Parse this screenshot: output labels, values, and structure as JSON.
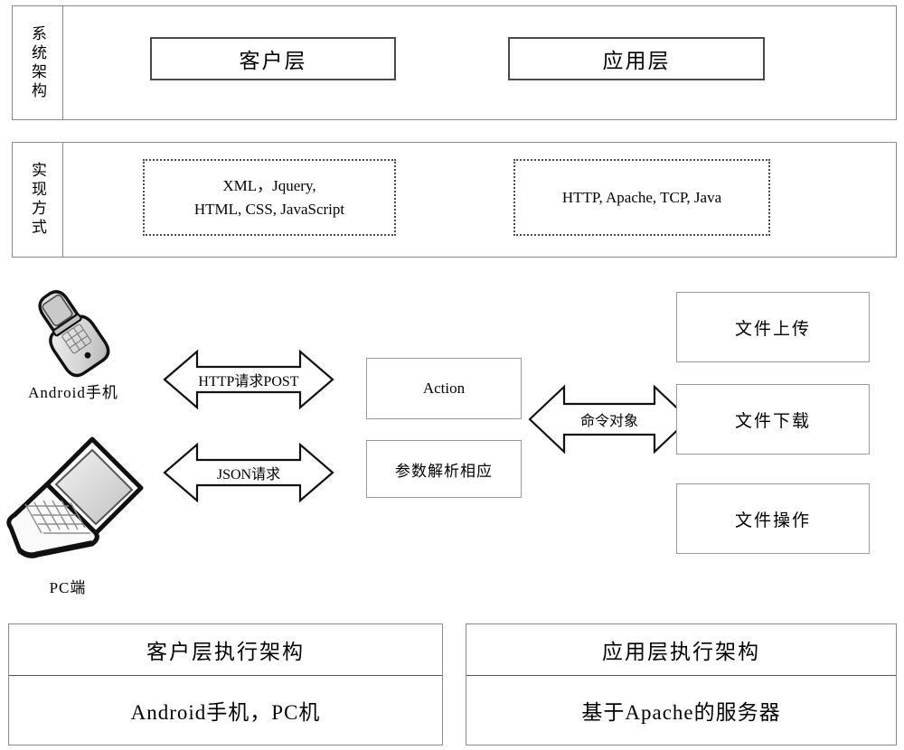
{
  "figure": {
    "type": "architecture-diagram",
    "rows": [
      {
        "label": "系统架构",
        "items": [
          {
            "text": "客户层"
          },
          {
            "text": "应用层"
          }
        ]
      },
      {
        "label": "实现方式",
        "items": [
          {
            "line1": "XML，Jquery,",
            "line2": "HTML, CSS, JavaScript"
          },
          {
            "line1": "HTTP, Apache, TCP, Java",
            "line2": ""
          }
        ]
      }
    ],
    "middle": {
      "devices": [
        {
          "icon": "mobile-phone-icon",
          "label": "Android手机"
        },
        {
          "icon": "laptop-icon",
          "label": "PC端"
        }
      ],
      "request_arrows": [
        {
          "label": "HTTP请求POST"
        },
        {
          "label": "JSON请求"
        }
      ],
      "server_boxes": [
        {
          "text": "Action"
        },
        {
          "text": "参数解析相应"
        }
      ],
      "command_arrow": {
        "label": "命令对象"
      },
      "operations": [
        {
          "text": "文件上传"
        },
        {
          "text": "文件下载"
        },
        {
          "text": "文件操作"
        }
      ]
    },
    "bottom": [
      {
        "header": "客户层执行架构",
        "body": "Android手机，PC机"
      },
      {
        "header": "应用层执行架构",
        "body": "基于Apache的服务器"
      }
    ]
  }
}
